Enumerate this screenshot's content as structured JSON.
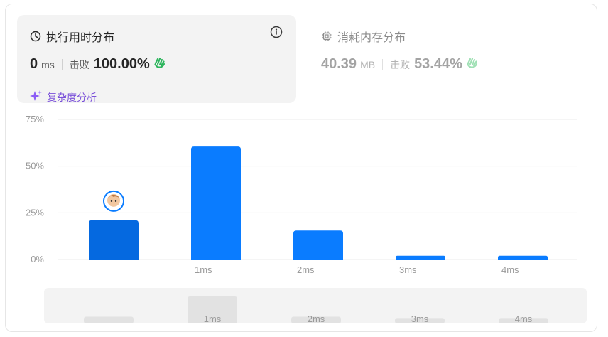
{
  "runtime": {
    "title": "执行用时分布",
    "value": "0",
    "unit": "ms",
    "beat_label": "击败",
    "beat_value": "100.00%",
    "analysis_link": "复杂度分析"
  },
  "memory": {
    "title": "消耗内存分布",
    "value": "40.39",
    "unit": "MB",
    "beat_label": "击败",
    "beat_value": "53.44%"
  },
  "colors": {
    "bar": "#0a7cff",
    "bar_selected": "#0569e0",
    "link": "#7a50d9",
    "hand": "#2db55d"
  },
  "chart_data": {
    "type": "bar",
    "categories": [
      "",
      "1ms",
      "2ms",
      "3ms",
      "4ms"
    ],
    "values": [
      21,
      60.5,
      15.5,
      2,
      2
    ],
    "ylim": [
      0,
      75
    ],
    "yticks": [
      "0%",
      "25%",
      "50%",
      "75%"
    ],
    "ytick_values": [
      0,
      25,
      50,
      75
    ],
    "selected_index": 0,
    "overview_labels": [
      "",
      "1ms",
      "2ms",
      "3ms",
      "4ms"
    ],
    "overview_values": [
      1,
      4,
      1,
      0.8,
      0.8
    ],
    "grid": true
  }
}
